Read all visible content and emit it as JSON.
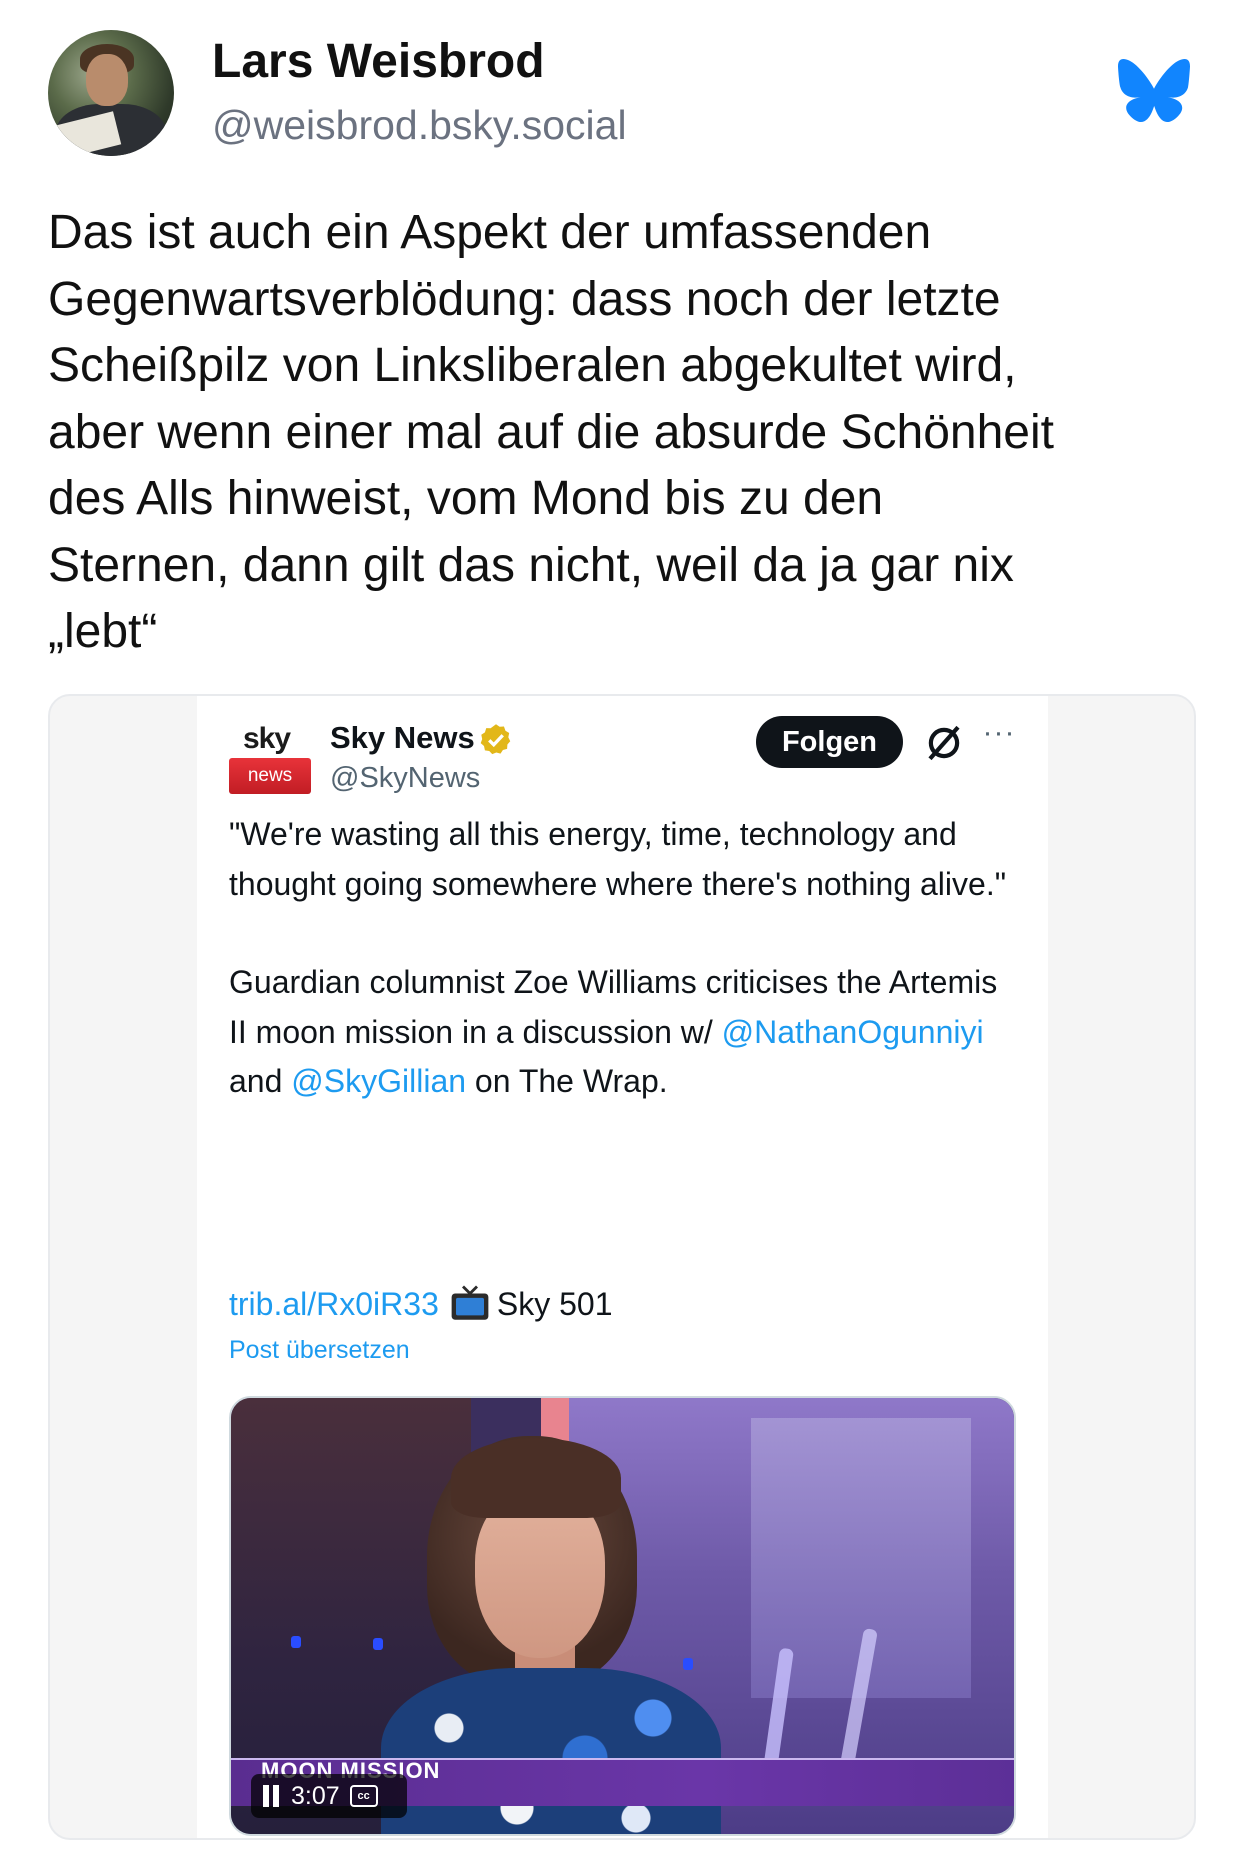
{
  "post": {
    "author_name": "Lars Weisbrod",
    "author_handle": "@weisbrod.bsky.social",
    "text": "Das ist auch ein Aspekt der umfassenden\nGegenwartsverblödung: dass noch der letzte\nScheißpilz von Linksliberalen abgekultet wird,\naber wenn einer mal auf die absurde Schönheit\ndes Alls hinweist, vom Mond bis zu den\nSternen, dann gilt das nicht, weil da ja gar nix\n„lebt“",
    "brand_color": "#1185fe"
  },
  "embed": {
    "logo_sky": "sky",
    "logo_news": "news",
    "account_name": "Sky News",
    "account_handle": "@SkyNews",
    "follow_label": "Folgen",
    "more_label": "···",
    "quote": "\"We're wasting all this energy, time, technology and thought going somewhere where there's nothing alive.\"",
    "body_prefix": "Guardian columnist Zoe Williams criticises the Artemis II moon mission in a discussion w/ ",
    "mention_1": "@NathanOgunniyi",
    "body_mid": " and ",
    "mention_2": "@SkyGillian",
    "body_suffix": " on The Wrap.",
    "link": "trib.al/Rx0iR33",
    "channel": "Sky 501",
    "translate": "Post übersetzen",
    "video": {
      "ticker": "MOON MISSION",
      "duration": "3:07",
      "cc": "cc"
    },
    "accent_color": "#1d9bf0"
  }
}
